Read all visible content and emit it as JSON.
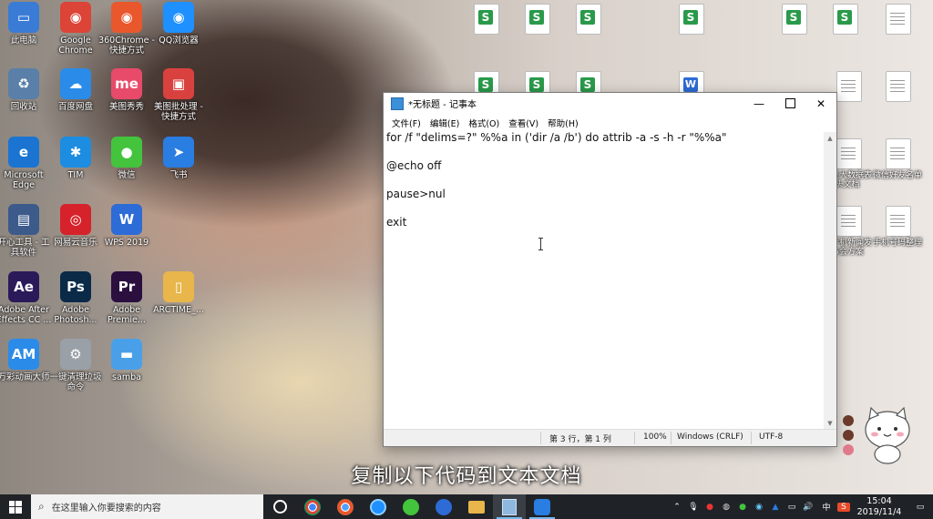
{
  "desktop_icons": [
    {
      "label": "此电脑",
      "color": "#3a7bd5",
      "glyph": "▭"
    },
    {
      "label": "Google Chrome",
      "color": "#db4437",
      "glyph": "◉"
    },
    {
      "label": "360Chrome - 快捷方式",
      "color": "#e9572d",
      "glyph": "◉"
    },
    {
      "label": "QQ浏览器",
      "color": "#1e90ff",
      "glyph": "◉"
    },
    {
      "label": "回收站",
      "color": "#5a7fa8",
      "glyph": "♻"
    },
    {
      "label": "百度网盘",
      "color": "#2a8be8",
      "glyph": "☁"
    },
    {
      "label": "美图秀秀",
      "color": "#e84a6a",
      "glyph": "me"
    },
    {
      "label": "美图批处理 - 快捷方式",
      "color": "#d9413f",
      "glyph": "▣"
    },
    {
      "label": "Microsoft Edge",
      "color": "#1b74d1",
      "glyph": "e"
    },
    {
      "label": "TIM",
      "color": "#1c8de0",
      "glyph": "✱"
    },
    {
      "label": "微信",
      "color": "#43c43c",
      "glyph": "●"
    },
    {
      "label": "飞书",
      "color": "#2a7de1",
      "glyph": "➤"
    },
    {
      "label": "开心工具 - 工具软件",
      "color": "#3c5a8a",
      "glyph": "▤"
    },
    {
      "label": "网易云音乐",
      "color": "#d6222a",
      "glyph": "◎"
    },
    {
      "label": "WPS 2019",
      "color": "#2d6bd6",
      "glyph": "W"
    },
    {
      "label": "Adobe After Effects CC ...",
      "color": "#2b1a5a",
      "glyph": "Ae"
    },
    {
      "label": "Adobe Photosh...",
      "color": "#0a2a48",
      "glyph": "Ps"
    },
    {
      "label": "Adobe Premie...",
      "color": "#2a0f3f",
      "glyph": "Pr"
    },
    {
      "label": "ARCTIME_...",
      "color": "#e8b64a",
      "glyph": "▯"
    },
    {
      "label": "万彩动画大师",
      "color": "#2a8be8",
      "glyph": "AM"
    },
    {
      "label": "一键清理垃圾命令",
      "color": "#9aa0a8",
      "glyph": "⚙"
    },
    {
      "label": "samba",
      "color": "#4aa0e8",
      "glyph": "▬"
    }
  ],
  "desktop_files": {
    "file_a_label": "",
    "file_b_label": "",
    "file_c_label": "",
    "file_d_label": "回复大数据表头文档",
    "file_e_label": "微信好友名单",
    "file_f_label": "新手机新闻发布会方案",
    "file_g_label": "手机号码整理"
  },
  "notepad": {
    "title": "*无标题 - 记事本",
    "menu": [
      "文件(F)",
      "编辑(E)",
      "格式(O)",
      "查看(V)",
      "帮助(H)"
    ],
    "lines": [
      "for /f \"delims=?\" %%a in ('dir /a /b') do attrib -a -s -h -r \"%%a\"",
      "@echo off",
      "pause>nul",
      "exit"
    ],
    "status": {
      "position": "第 3 行，第 1 列",
      "zoom": "100%",
      "line_ending": "Windows (CRLF)",
      "encoding": "UTF-8"
    }
  },
  "subtitle": "复制以下代码到文本文档",
  "taskbar": {
    "search_placeholder": "在这里输入你要搜索的内容",
    "apps": [
      {
        "name": "task-view",
        "color": "#ffffff"
      },
      {
        "name": "chrome",
        "color": "#db4437"
      },
      {
        "name": "360chrome",
        "color": "#e9572d"
      },
      {
        "name": "qq-browser",
        "color": "#1e90ff"
      },
      {
        "name": "wechat",
        "color": "#43c43c"
      },
      {
        "name": "wps",
        "color": "#2d6bd6"
      },
      {
        "name": "file-explorer",
        "color": "#e8b64a"
      },
      {
        "name": "notepad",
        "color": "#8fb8e0"
      },
      {
        "name": "feishu",
        "color": "#2a7de1"
      }
    ],
    "ime": "中",
    "time": "15:04",
    "date": "2019/11/4"
  }
}
